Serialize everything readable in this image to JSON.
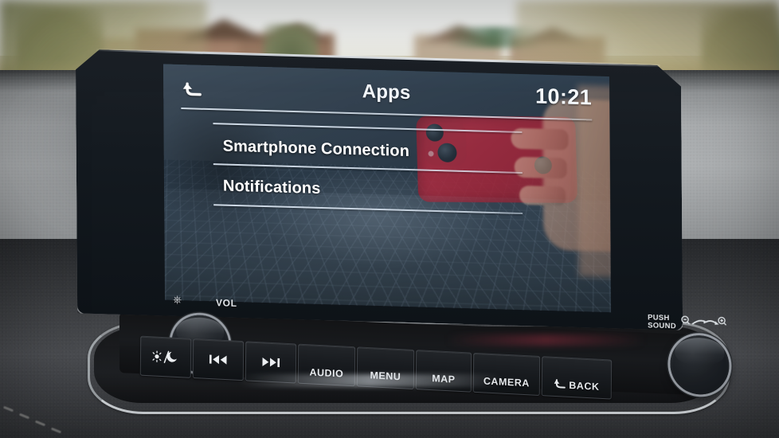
{
  "scene": {
    "description": "Nissan Qashqai infotainment head unit showing the Apps menu, photographed from the passenger seat"
  },
  "screen": {
    "header": {
      "back_icon": "back-arrow-icon",
      "title": "Apps",
      "clock": "10:21"
    },
    "menu_items": [
      {
        "label": "Smartphone Connection"
      },
      {
        "label": "Notifications"
      }
    ]
  },
  "controls": {
    "left_knob": {
      "power_icon": "power-icon",
      "label": "VOL",
      "name": "volume-power-knob"
    },
    "right_knob": {
      "label_line1": "PUSH",
      "label_line2": "SOUND",
      "zoom_out_icon": "zoom-out-icon",
      "zoom_in_icon": "zoom-in-icon",
      "name": "tune-sound-knob"
    }
  },
  "hardware_buttons": [
    {
      "label": "",
      "icon": "day-night-display-icon",
      "name": "display-day-night-button"
    },
    {
      "label": "",
      "icon": "previous-track-icon",
      "name": "previous-track-button"
    },
    {
      "label": "",
      "icon": "next-track-icon",
      "name": "next-track-button"
    },
    {
      "label": "AUDIO",
      "icon": "",
      "name": "audio-button"
    },
    {
      "label": "MENU",
      "icon": "",
      "name": "menu-button"
    },
    {
      "label": "MAP",
      "icon": "",
      "name": "map-button"
    },
    {
      "label": "CAMERA",
      "icon": "",
      "name": "camera-button"
    },
    {
      "label": "BACK",
      "icon": "back-arrow-icon",
      "name": "back-button"
    }
  ],
  "colors": {
    "screen_bg": "#2a3947",
    "screen_text": "#ffffff",
    "dashboard": "#a8abad",
    "console": "#3c3e41",
    "phone_reflection": "#a82438"
  }
}
